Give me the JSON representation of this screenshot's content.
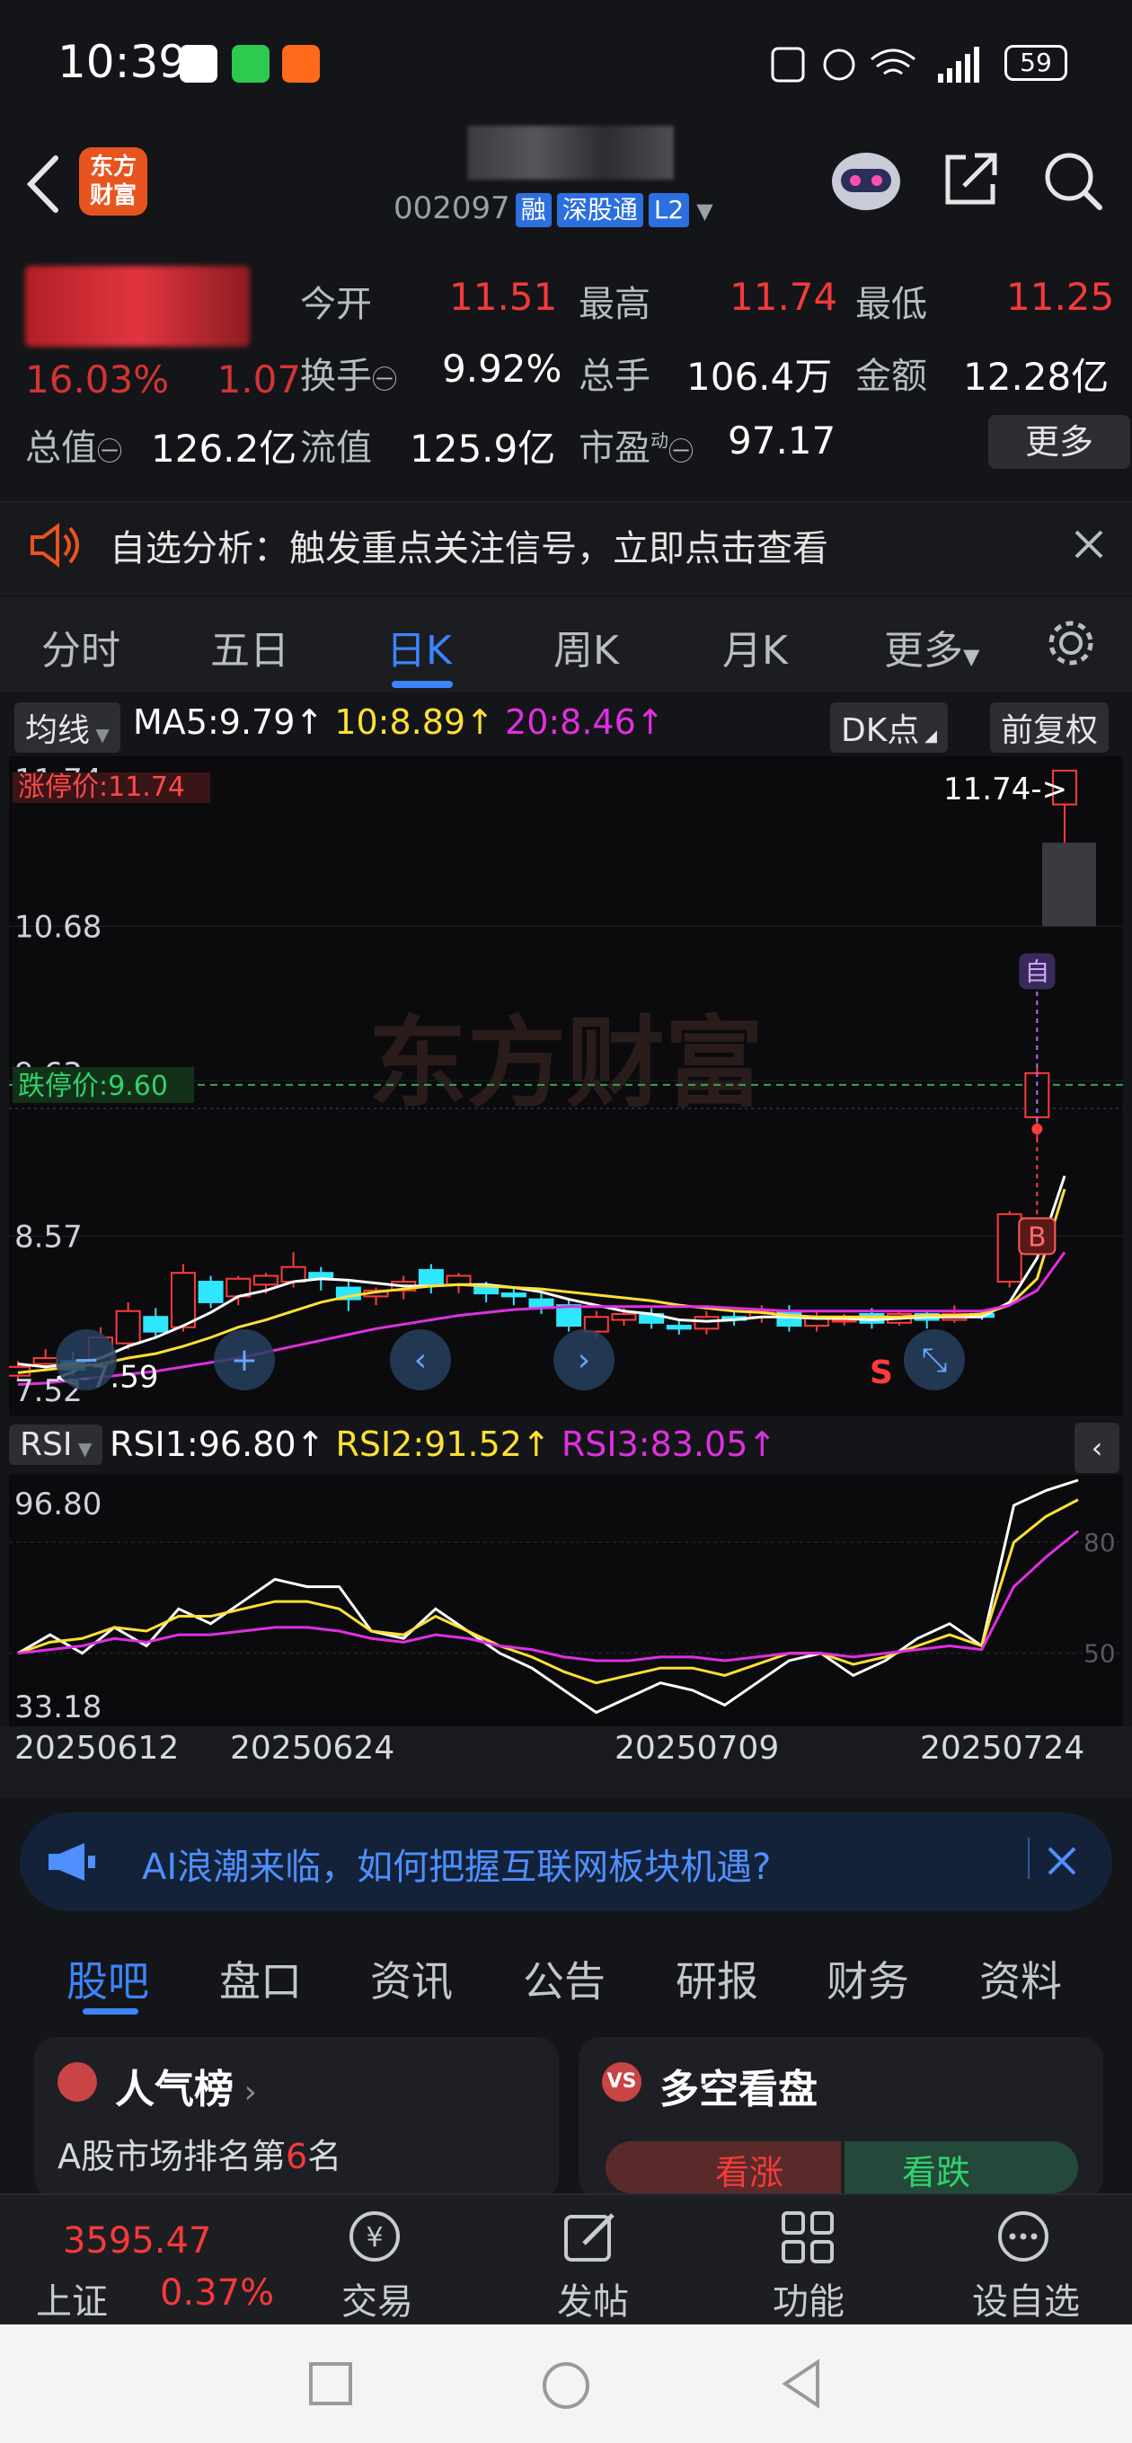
{
  "status_bar": {
    "time": "10:39",
    "battery": "59",
    "icons": [
      "nfc-icon",
      "alarm-off-icon",
      "wifi-icon",
      "signal-icon",
      "battery-icon"
    ]
  },
  "header": {
    "logo_text": "东方\n财富",
    "code": "002097",
    "tags": [
      "融",
      "深股通",
      "L2"
    ]
  },
  "quote": {
    "change": "16.03%",
    "change_abs": "1.07",
    "fields": [
      {
        "label": "今开",
        "value": "11.51",
        "color": "red"
      },
      {
        "label": "最高",
        "value": "11.74",
        "color": "red"
      },
      {
        "label": "最低",
        "value": "11.25",
        "color": "red"
      },
      {
        "label": "换手",
        "value": "9.92%",
        "color": "white"
      },
      {
        "label": "总手",
        "value": "106.4万",
        "color": "white"
      },
      {
        "label": "金额",
        "value": "12.28亿",
        "color": "white"
      },
      {
        "label": "总值",
        "value": "126.2亿",
        "color": "white"
      },
      {
        "label": "流值",
        "value": "125.9亿",
        "color": "white"
      },
      {
        "label": "市盈",
        "value": "97.17",
        "color": "white",
        "sup": "动"
      }
    ],
    "more": "更多"
  },
  "notice": {
    "text": "自选分析：触发重点关注信号，立即点击查看"
  },
  "period_tabs": [
    "分时",
    "五日",
    "日K",
    "周K",
    "月K",
    "更多"
  ],
  "ma_bar": {
    "selector": "均线",
    "ma5": "MA5:9.79↑",
    "ma10": "10:8.89↑",
    "ma20": "20:8.46↑",
    "dk": "DK点",
    "fq": "前复权"
  },
  "kline": {
    "ytick_top": "11.74",
    "limit_up": "涨停价:11.74",
    "ytick_2": "10.68",
    "ytick_3": "9.63",
    "limit_down": "跌停价:9.60",
    "ytick_4": "8.57",
    "ytick_bottom": "7.52",
    "last_price_label": "11.74->",
    "low_label": "<-7.59",
    "mark_zi": "自",
    "mark_b": "B",
    "mark_s": "S",
    "watermark": "东方财富"
  },
  "chart_data": [
    {
      "type": "candlestick",
      "title": "日K",
      "ylim": [
        7.52,
        11.74
      ],
      "yticks": [
        11.74,
        10.68,
        9.63,
        8.57,
        7.52
      ],
      "xticks": [
        "20250612",
        "20250624",
        "20250709",
        "20250724"
      ],
      "candles": [
        {
          "o": 7.62,
          "c": 7.68,
          "h": 7.72,
          "l": 7.59
        },
        {
          "o": 7.7,
          "c": 7.74,
          "h": 7.8,
          "l": 7.65
        },
        {
          "o": 7.72,
          "c": 7.66,
          "h": 7.78,
          "l": 7.62
        },
        {
          "o": 7.7,
          "c": 7.88,
          "h": 7.95,
          "l": 7.66
        },
        {
          "o": 7.84,
          "c": 8.06,
          "h": 8.12,
          "l": 7.8
        },
        {
          "o": 8.02,
          "c": 7.92,
          "h": 8.08,
          "l": 7.88
        },
        {
          "o": 7.95,
          "c": 8.32,
          "h": 8.38,
          "l": 7.92
        },
        {
          "o": 8.26,
          "c": 8.12,
          "h": 8.3,
          "l": 8.08
        },
        {
          "o": 8.16,
          "c": 8.28,
          "h": 8.3,
          "l": 8.1
        },
        {
          "o": 8.24,
          "c": 8.3,
          "h": 8.32,
          "l": 8.18
        },
        {
          "o": 8.26,
          "c": 8.36,
          "h": 8.46,
          "l": 8.22
        },
        {
          "o": 8.32,
          "c": 8.28,
          "h": 8.36,
          "l": 8.2
        },
        {
          "o": 8.22,
          "c": 8.14,
          "h": 8.26,
          "l": 8.06
        },
        {
          "o": 8.16,
          "c": 8.2,
          "h": 8.22,
          "l": 8.1
        },
        {
          "o": 8.2,
          "c": 8.26,
          "h": 8.3,
          "l": 8.14
        },
        {
          "o": 8.34,
          "c": 8.24,
          "h": 8.38,
          "l": 8.18
        },
        {
          "o": 8.24,
          "c": 8.3,
          "h": 8.32,
          "l": 8.18
        },
        {
          "o": 8.22,
          "c": 8.18,
          "h": 8.26,
          "l": 8.12
        },
        {
          "o": 8.18,
          "c": 8.16,
          "h": 8.22,
          "l": 8.1
        },
        {
          "o": 8.14,
          "c": 8.08,
          "h": 8.18,
          "l": 8.04
        },
        {
          "o": 8.1,
          "c": 7.96,
          "h": 8.14,
          "l": 7.92
        },
        {
          "o": 7.92,
          "c": 8.02,
          "h": 8.06,
          "l": 7.88
        },
        {
          "o": 8.0,
          "c": 8.04,
          "h": 8.08,
          "l": 7.96
        },
        {
          "o": 8.04,
          "c": 7.98,
          "h": 8.08,
          "l": 7.94
        },
        {
          "o": 7.96,
          "c": 7.94,
          "h": 8.0,
          "l": 7.9
        },
        {
          "o": 7.94,
          "c": 8.02,
          "h": 8.06,
          "l": 7.9
        },
        {
          "o": 8.02,
          "c": 8.0,
          "h": 8.06,
          "l": 7.96
        },
        {
          "o": 8.02,
          "c": 8.06,
          "h": 8.1,
          "l": 7.98
        },
        {
          "o": 8.06,
          "c": 7.96,
          "h": 8.1,
          "l": 7.92
        },
        {
          "o": 7.96,
          "c": 8.02,
          "h": 8.06,
          "l": 7.92
        },
        {
          "o": 8.0,
          "c": 8.0,
          "h": 8.04,
          "l": 7.96
        },
        {
          "o": 8.04,
          "c": 7.98,
          "h": 8.08,
          "l": 7.94
        },
        {
          "o": 7.98,
          "c": 8.04,
          "h": 8.06,
          "l": 7.96
        },
        {
          "o": 8.04,
          "c": 8.0,
          "h": 8.06,
          "l": 7.94
        },
        {
          "o": 8.0,
          "c": 8.04,
          "h": 8.1,
          "l": 7.98
        },
        {
          "o": 8.04,
          "c": 8.02,
          "h": 8.06,
          "l": 8.0
        },
        {
          "o": 8.26,
          "c": 8.72,
          "h": 8.74,
          "l": 8.22
        },
        {
          "o": 9.38,
          "c": 9.68,
          "h": 9.72,
          "l": 9.22
        },
        {
          "o": 11.51,
          "c": 11.74,
          "h": 11.74,
          "l": 11.25
        }
      ],
      "ma_series": [
        {
          "name": "MA5",
          "color": "#ffffff",
          "values": [
            7.7,
            7.68,
            7.7,
            7.74,
            7.82,
            7.88,
            7.96,
            8.05,
            8.16,
            8.2,
            8.26,
            8.28,
            8.27,
            8.25,
            8.23,
            8.23,
            8.24,
            8.24,
            8.22,
            8.19,
            8.14,
            8.1,
            8.06,
            8.04,
            8.0,
            7.99,
            8.0,
            8.02,
            8.02,
            8.01,
            8.01,
            8.0,
            8.01,
            8.02,
            8.02,
            8.02,
            8.12,
            8.42,
            8.98
          ]
        },
        {
          "name": "MA10",
          "color": "#ffe033",
          "values": [
            7.64,
            7.66,
            7.68,
            7.7,
            7.74,
            7.77,
            7.82,
            7.88,
            7.95,
            8.0,
            8.06,
            8.12,
            8.16,
            8.19,
            8.21,
            8.23,
            8.24,
            8.23,
            8.22,
            8.21,
            8.19,
            8.17,
            8.15,
            8.13,
            8.1,
            8.08,
            8.06,
            8.05,
            8.03,
            8.02,
            8.02,
            8.02,
            8.02,
            8.03,
            8.03,
            8.04,
            8.1,
            8.28,
            8.89
          ]
        },
        {
          "name": "MA20",
          "color": "#e12fe1",
          "values": [
            7.56,
            7.57,
            7.59,
            7.61,
            7.63,
            7.65,
            7.68,
            7.71,
            7.74,
            7.78,
            7.82,
            7.86,
            7.9,
            7.94,
            7.97,
            8.0,
            8.03,
            8.05,
            8.07,
            8.08,
            8.09,
            8.09,
            8.09,
            8.09,
            8.09,
            8.09,
            8.08,
            8.07,
            8.06,
            8.06,
            8.06,
            8.06,
            8.06,
            8.06,
            8.06,
            8.06,
            8.1,
            8.2,
            8.46
          ]
        }
      ]
    },
    {
      "type": "line",
      "title": "RSI",
      "ylim": [
        33.18,
        96.8
      ],
      "series": [
        {
          "name": "RSI1",
          "color": "#ffffff",
          "values": [
            50,
            55,
            50,
            57,
            52,
            62,
            58,
            64,
            70,
            68,
            68,
            56,
            54,
            62,
            56,
            50,
            46,
            40,
            34,
            38,
            42,
            40,
            36,
            42,
            48,
            50,
            44,
            48,
            54,
            58,
            52,
            90,
            94,
            96.8
          ]
        },
        {
          "name": "RSI2",
          "color": "#ffe033",
          "values": [
            50,
            53,
            54,
            57,
            56,
            60,
            60,
            62,
            64,
            64,
            62,
            56,
            55,
            60,
            56,
            52,
            49,
            45,
            42,
            44,
            46,
            46,
            44,
            47,
            50,
            50,
            47,
            49,
            52,
            55,
            52,
            80,
            87,
            91.52
          ]
        },
        {
          "name": "RSI3",
          "color": "#e12fe1",
          "values": [
            50,
            51,
            52,
            54,
            53,
            55,
            55,
            56,
            57,
            57,
            56,
            54,
            53,
            55,
            54,
            52,
            51,
            49,
            48,
            48,
            49,
            49,
            48,
            49,
            50,
            50,
            49,
            50,
            51,
            52,
            51,
            68,
            76,
            83.05
          ]
        }
      ]
    }
  ],
  "rsi_bar": {
    "selector": "RSI",
    "rsi1": "RSI1:96.80↑",
    "rsi2": "RSI2:91.52↑",
    "rsi3": "RSI3:83.05↑",
    "ytop": "96.80",
    "ybottom": "33.18",
    "ref80": "80",
    "ref50": "50"
  },
  "dates": [
    "20250612",
    "20250624",
    "20250709",
    "20250724"
  ],
  "ai_banner": {
    "text": "AI浪潮来临，如何把握互联网板块机遇?"
  },
  "info_tabs": [
    "股吧",
    "盘口",
    "资讯",
    "公告",
    "研报",
    "财务",
    "资料"
  ],
  "cards": {
    "popularity_title": "人气榜",
    "popularity_sub_prefix": "A股市场排名第",
    "popularity_rank": "6",
    "popularity_sub_suffix": "名",
    "duokong_title": "多空看盘",
    "bull_label": "看涨",
    "bear_label": "看跌"
  },
  "bottom_nav": {
    "index_value": "3595.47",
    "index_name": "上证",
    "index_change": "0.37%",
    "items": [
      "交易",
      "发帖",
      "功能",
      "设自选"
    ]
  }
}
